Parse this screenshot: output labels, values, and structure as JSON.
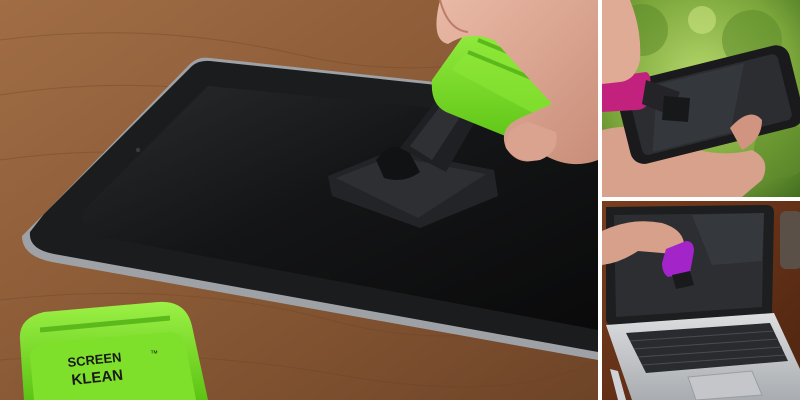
{
  "product": {
    "brand_line1": "SCREEN",
    "brand_line2": "KLEAN",
    "trademark": "™"
  },
  "colors": {
    "wood": "#8a5a36",
    "tablet_bezel": "#1b1c1e",
    "tablet_frame": "#9ea2a6",
    "cleaner_green": "#7ee02a",
    "cleaner_magenta": "#c2227d",
    "foliage": "#7aa53a",
    "laptop_silver": "#c9cbce"
  },
  "icons": {
    "cleaner_main": "green-screen-cleaner-icon",
    "cleaner_phone": "magenta-screen-cleaner-icon",
    "cleaner_laptop": "purple-screen-cleaner-icon"
  }
}
